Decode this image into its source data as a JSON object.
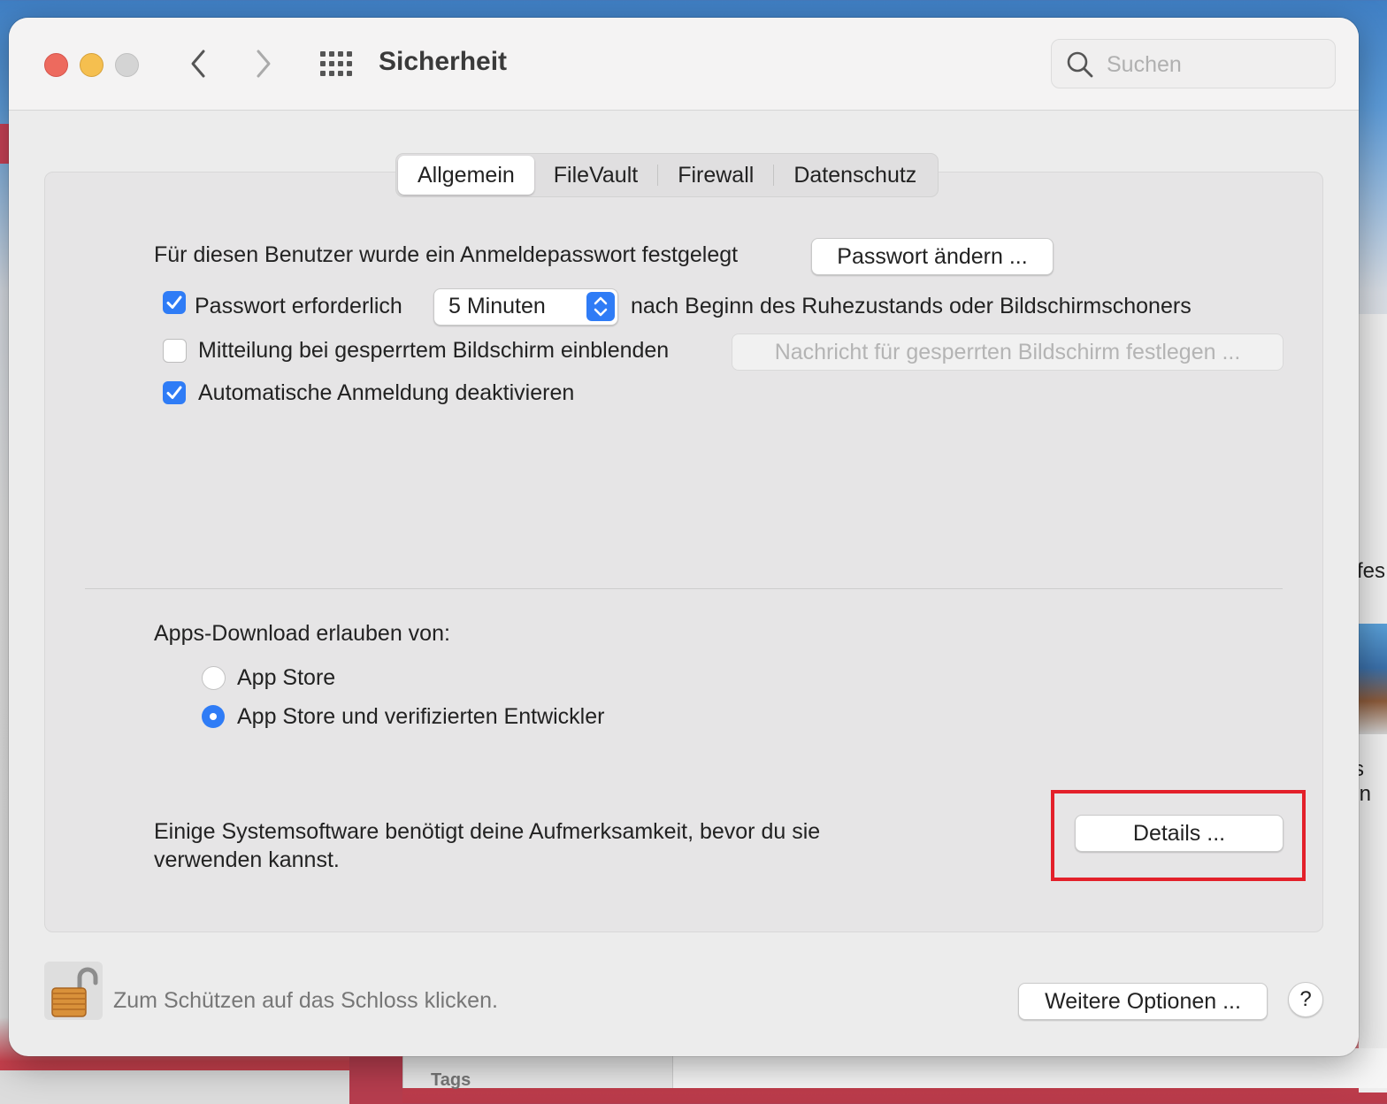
{
  "window": {
    "title": "Sicherheit"
  },
  "search": {
    "placeholder": "Suchen"
  },
  "tabs": [
    {
      "label": "Allgemein",
      "active": true
    },
    {
      "label": "FileVault",
      "active": false
    },
    {
      "label": "Firewall",
      "active": false
    },
    {
      "label": "Datenschutz",
      "active": false
    }
  ],
  "general": {
    "password_text": "Für diesen Benutzer wurde ein Anmeldepasswort festgelegt",
    "change_password_button": "Passwort ändern ...",
    "require_password_label": "Passwort erforderlich",
    "require_password_checked": true,
    "require_password_delay": "5 Minuten",
    "require_password_suffix": "nach Beginn des Ruhezustands oder Bildschirmschoners",
    "lock_message_label": "Mitteilung bei gesperrtem Bildschirm einblenden",
    "lock_message_checked": false,
    "lock_message_button": "Nachricht für gesperrten Bildschirm festlegen ...",
    "auto_login_label": "Automatische Anmeldung deaktivieren",
    "auto_login_checked": true
  },
  "downloads": {
    "heading": "Apps-Download erlauben von:",
    "options": [
      {
        "label": "App Store",
        "selected": false
      },
      {
        "label": "App Store und verifizierten Entwickler",
        "selected": true
      }
    ]
  },
  "attention": {
    "text_line1": "Einige Systemsoftware benötigt deine Aufmerksamkeit, bevor du sie",
    "text_line2": "verwenden kannst.",
    "details_button": "Details ..."
  },
  "footer": {
    "lock_text": "Zum Schützen auf das Schloss klicken.",
    "more_options_button": "Weitere Optionen ...",
    "help_button": "?"
  },
  "background": {
    "right_text1": "fes",
    "right_text2": "s In",
    "tags_label": "Tags"
  },
  "colors": {
    "accent": "#2f7cf6",
    "highlight": "#e3202a",
    "close": "#ed6a5e",
    "minimize": "#f5bf4f",
    "zoom": "#d4d4d4"
  },
  "icons": {
    "back": "chevron-left-icon",
    "forward": "chevron-right-icon",
    "show_all": "grid-icon",
    "search": "magnifier-icon",
    "lock": "open-padlock-icon",
    "checkmark": "checkmark-icon",
    "stepper": "up-down-chevron-icon"
  }
}
